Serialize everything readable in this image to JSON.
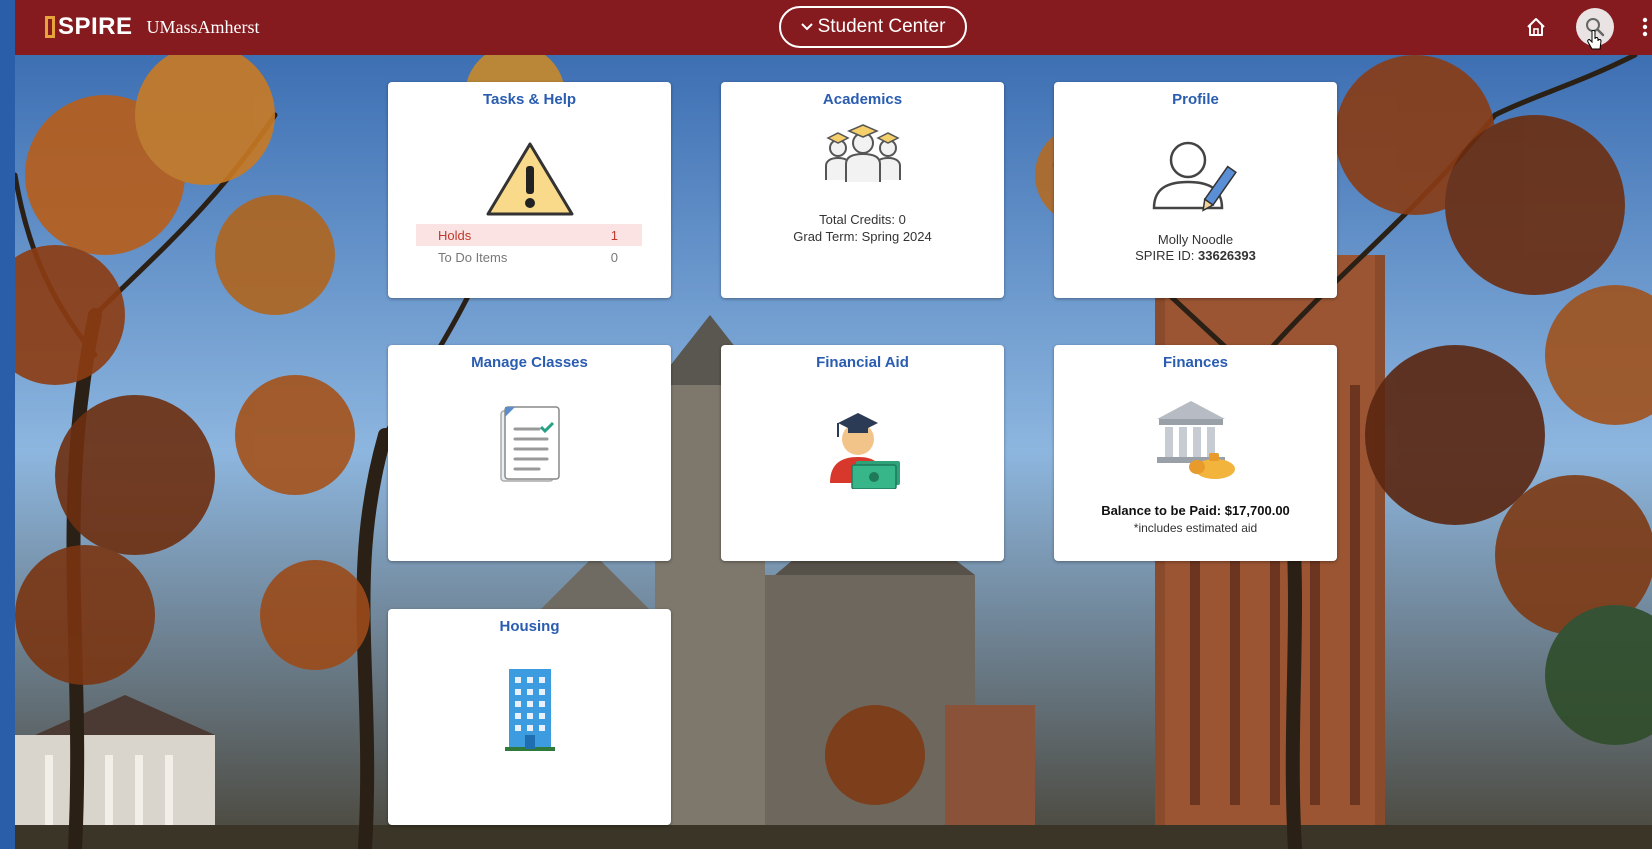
{
  "header": {
    "brand_name": "SPIRE",
    "institution": "UMassAmherst",
    "nav_label": "Student Center",
    "colors": {
      "header_bg": "#861b1f",
      "accent": "#e8a33a",
      "tile_title": "#2a5db0"
    }
  },
  "tiles": {
    "tasks": {
      "title": "Tasks & Help",
      "icon": "warning-icon",
      "rows": [
        {
          "label": "Holds",
          "count": "1"
        },
        {
          "label": "To Do Items",
          "count": "0"
        }
      ]
    },
    "academics": {
      "title": "Academics",
      "icon": "graduates-icon",
      "total_credits": "Total Credits: 0",
      "grad_term": "Grad Term: Spring 2024"
    },
    "profile": {
      "title": "Profile",
      "icon": "user-edit-icon",
      "name": "Molly Noodle",
      "id_label": "SPIRE ID: ",
      "id_value": "33626393"
    },
    "manage_classes": {
      "title": "Manage Classes",
      "icon": "document-checklist-icon"
    },
    "financial_aid": {
      "title": "Financial Aid",
      "icon": "graduate-money-icon"
    },
    "finances": {
      "title": "Finances",
      "icon": "bank-icon",
      "balance": "Balance to be Paid: $17,700.00",
      "note": "*includes estimated aid"
    },
    "housing": {
      "title": "Housing",
      "icon": "building-icon"
    }
  }
}
